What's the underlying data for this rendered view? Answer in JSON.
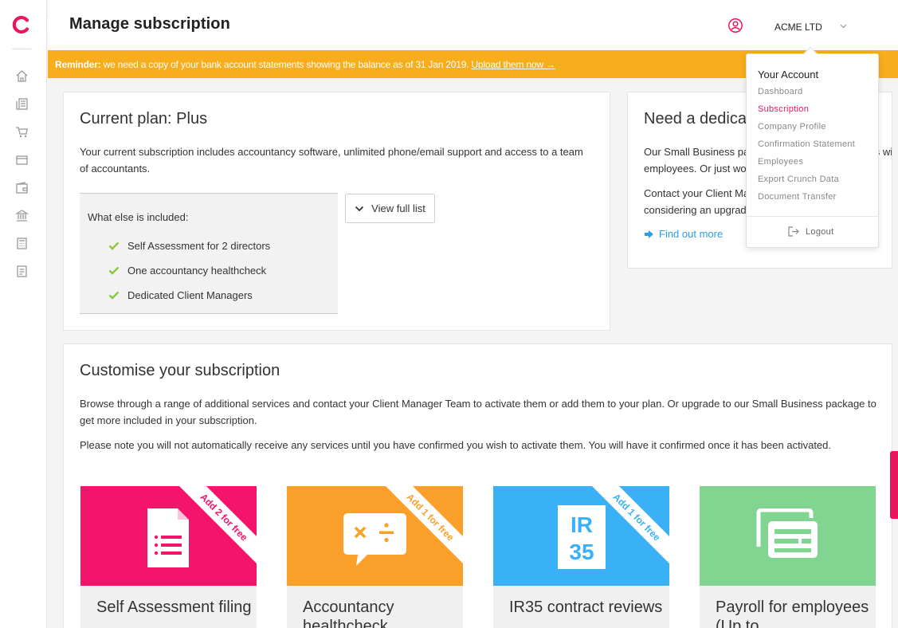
{
  "app": {
    "page_title": "Manage subscription",
    "company_name": "ACME LTD"
  },
  "banner": {
    "prefix": "Reminder:",
    "message": " we need a copy of your bank account statements showing the balance as of 31 Jan 2019. ",
    "link": "Upload them now →"
  },
  "plan": {
    "title": "Current plan: Plus",
    "description": "Your current subscription includes accountancy software, unlimited phone/email support and access to a team of accountants.",
    "included_title": "What else is included:",
    "items": [
      "Self Assessment for 2 directors",
      "One accountancy healthcheck",
      "Dedicated Client Managers"
    ],
    "view_button": "View full list"
  },
  "dedicated": {
    "title": "Need a dedicated",
    "para1": "Our Small Business package is ideal for companies with employees. Or just wondering",
    "para2": "Contact your Client Manager team if you are considering an upgrade",
    "link": "Find out more"
  },
  "customise": {
    "title": "Customise your subscription",
    "para1": "Browse through a range of additional services and contact your Client Manager Team to activate them or add them to your plan. Or upgrade to our Small Business package to get more included in your subscription.",
    "para2": "Please note you will not automatically receive any services until you have confirmed you wish to activate them. You will have it confirmed once it has been activated.",
    "tiles": [
      {
        "title": "Self Assessment filing",
        "ribbon": "Add 2 for free",
        "color": "#f4146b",
        "icon": "document-list-icon"
      },
      {
        "title": "Accountancy healthcheck",
        "ribbon": "Add 1 for free",
        "color": "#faa02a",
        "icon": "calculator-bubble-icon"
      },
      {
        "title": "IR35 contract reviews",
        "ribbon": "Add 1 for free",
        "color": "#3ab0f6",
        "icon": "ir35-icon",
        "icon_text_top": "IR",
        "icon_text_bottom": "35"
      },
      {
        "title": "Payroll for employees (Up to",
        "ribbon": "",
        "color": "#82d491",
        "icon": "payroll-cards-icon"
      }
    ]
  },
  "account_menu": {
    "title": "Your Account",
    "items": [
      "Dashboard",
      "Subscription",
      "Company Profile",
      "Confirmation Statement",
      "Employees",
      "Export Crunch Data",
      "Document Transfer"
    ],
    "active": "Subscription",
    "logout": "Logout"
  },
  "colors": {
    "brand": "#e8175d",
    "banner": "#f7ad1c",
    "link": "#2a9ee8",
    "check": "#8cc63f"
  }
}
